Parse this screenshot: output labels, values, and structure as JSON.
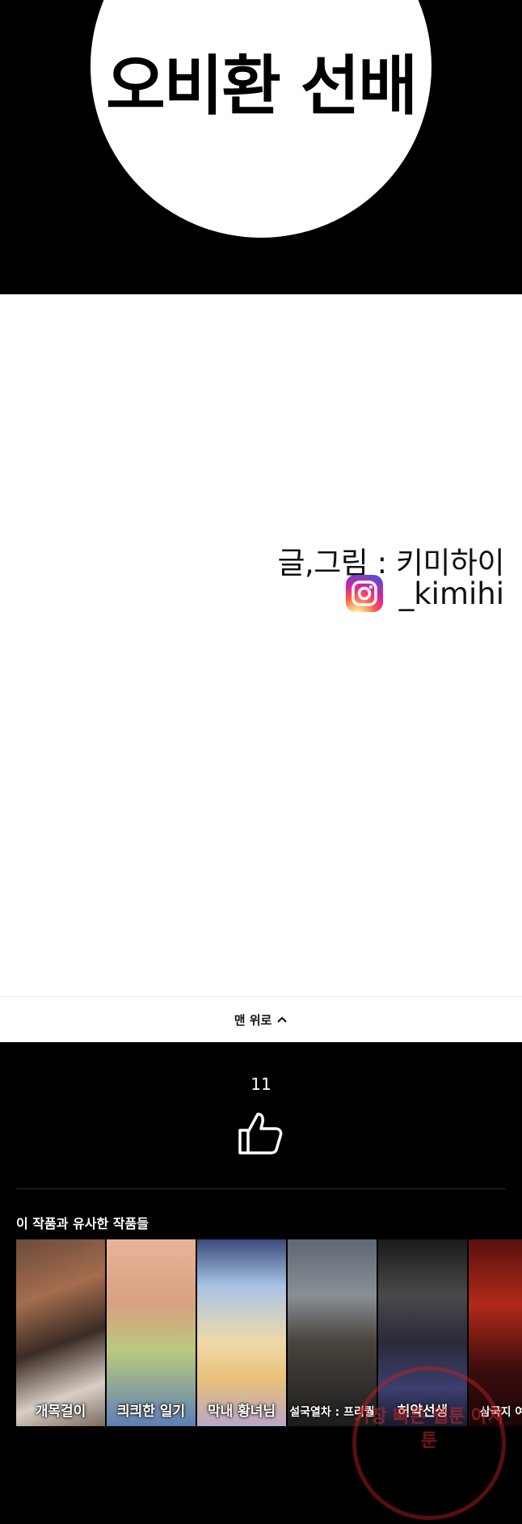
{
  "comic": {
    "title": "오비환 선배",
    "credits": "글,그림 : 키미하이",
    "instagram_handle": "_kimihi"
  },
  "nav": {
    "back_to_top": "맨 위로"
  },
  "likes": {
    "count": "11"
  },
  "similar": {
    "heading": "이 작품과 유사한 작품들",
    "items": [
      {
        "title": "개목걸이"
      },
      {
        "title": "킈킈한 일기"
      },
      {
        "title": "막내 황녀님"
      },
      {
        "title": "설국열차 : 프리퀄"
      },
      {
        "title": "허약선생"
      },
      {
        "title": "삼국지 여포전"
      }
    ]
  },
  "watermark": {
    "text": "가장 빠른 웹툰 아지툰"
  },
  "colors": {
    "background": "#000000",
    "panel": "#ffffff",
    "instagram_gradient": [
      "#fdf497",
      "#fd5949",
      "#d6249f",
      "#285AEB"
    ],
    "watermark": "#c81e1e"
  }
}
